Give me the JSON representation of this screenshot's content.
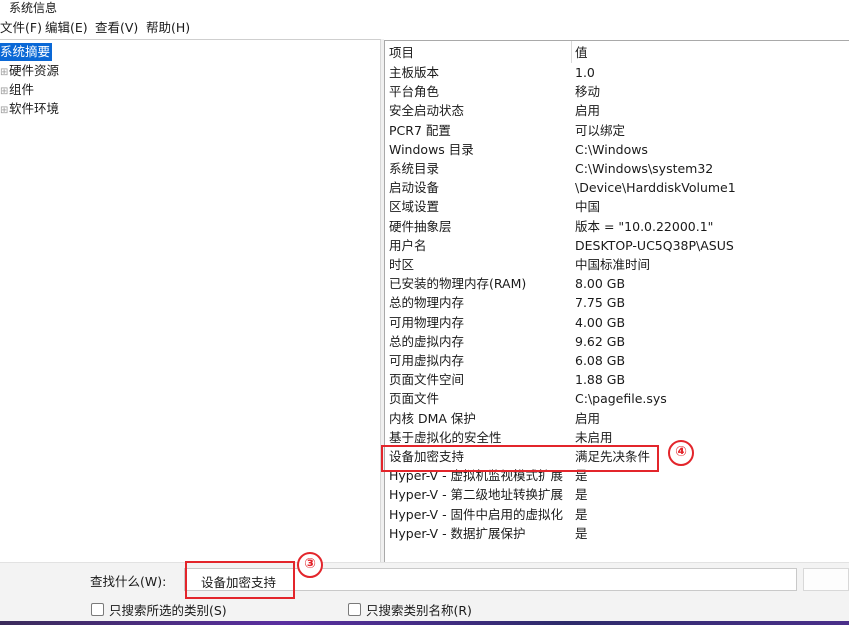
{
  "window": {
    "title": "系统信息"
  },
  "menu": {
    "items": [
      "文件(F)",
      "编辑(E)",
      "查看(V)",
      "帮助(H)"
    ]
  },
  "tree": {
    "items": [
      {
        "label": "系统摘要",
        "expander": ""
      },
      {
        "label": "硬件资源",
        "expander": "⊞"
      },
      {
        "label": "组件",
        "expander": "⊞"
      },
      {
        "label": "软件环境",
        "expander": "⊞"
      }
    ]
  },
  "table": {
    "headers": [
      "项目",
      "值"
    ],
    "rows": [
      [
        "主板版本",
        "1.0"
      ],
      [
        "平台角色",
        "移动"
      ],
      [
        "安全启动状态",
        "启用"
      ],
      [
        "PCR7 配置",
        "可以绑定"
      ],
      [
        "Windows 目录",
        "C:\\Windows"
      ],
      [
        "系统目录",
        "C:\\Windows\\system32"
      ],
      [
        "启动设备",
        "\\Device\\HarddiskVolume1"
      ],
      [
        "区域设置",
        "中国"
      ],
      [
        "硬件抽象层",
        "版本 = \"10.0.22000.1\""
      ],
      [
        "用户名",
        "DESKTOP-UC5Q38P\\ASUS"
      ],
      [
        "时区",
        "中国标准时间"
      ],
      [
        "已安装的物理内存(RAM)",
        "8.00 GB"
      ],
      [
        "总的物理内存",
        "7.75 GB"
      ],
      [
        "可用物理内存",
        "4.00 GB"
      ],
      [
        "总的虚拟内存",
        "9.62 GB"
      ],
      [
        "可用虚拟内存",
        "6.08 GB"
      ],
      [
        "页面文件空间",
        "1.88 GB"
      ],
      [
        "页面文件",
        "C:\\pagefile.sys"
      ],
      [
        "内核 DMA 保护",
        "启用"
      ],
      [
        "基于虚拟化的安全性",
        "未启用"
      ],
      [
        "设备加密支持",
        "满足先决条件"
      ],
      [
        "Hyper-V - 虚拟机监视模式扩展",
        "是"
      ],
      [
        "Hyper-V - 第二级地址转换扩展",
        "是"
      ],
      [
        "Hyper-V - 固件中启用的虚拟化",
        "是"
      ],
      [
        "Hyper-V - 数据扩展保护",
        "是"
      ]
    ]
  },
  "find": {
    "label": "查找什么(W):",
    "value": "设备加密支持",
    "option_selected_category": "只搜索所选的类别(S)",
    "option_category_names": "只搜索类别名称(R)"
  },
  "annotations": {
    "circle3": "③",
    "circle4": "④"
  },
  "colors": {
    "selection": "#0a68d6",
    "annotation": "#e3252b"
  }
}
